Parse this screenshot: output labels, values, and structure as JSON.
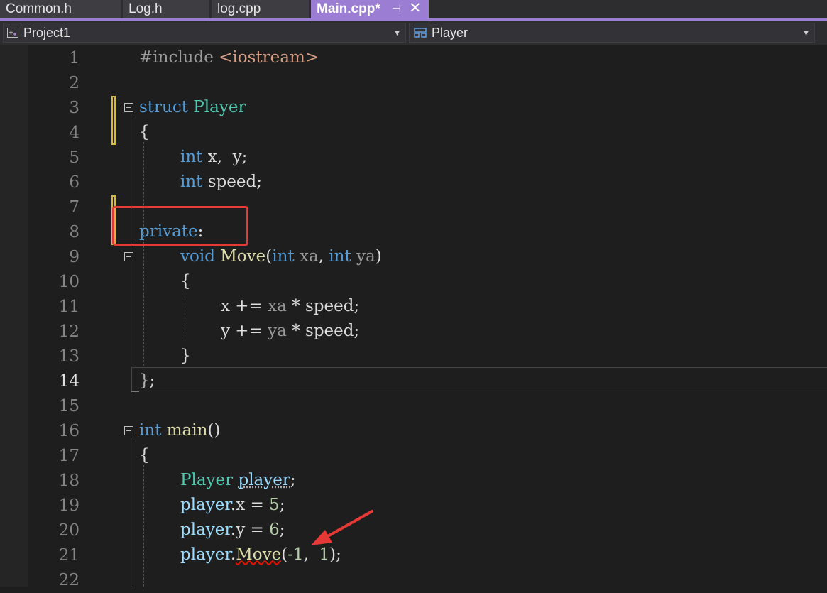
{
  "tabs": [
    {
      "label": "Common.h"
    },
    {
      "label": "Log.h"
    },
    {
      "label": "log.cpp"
    },
    {
      "label": "Main.cpp*",
      "pin": "⊣",
      "close": "✕"
    }
  ],
  "nav": {
    "project": "Project1",
    "member": "Player"
  },
  "editor": {
    "current_line": 14,
    "line_numbers": [
      "1",
      "2",
      "3",
      "4",
      "5",
      "6",
      "7",
      "8",
      "9",
      "10",
      "11",
      "12",
      "13",
      "14",
      "15",
      "16",
      "17",
      "18",
      "19",
      "20",
      "21",
      "22"
    ],
    "lines": {
      "l1": {
        "a": "#include ",
        "b": "<iostream>"
      },
      "l3": {
        "kw": "struct",
        "name": " Player"
      },
      "l4": "{",
      "l5": {
        "kw": "int",
        "rest": " x,  y;"
      },
      "l6": {
        "kw": "int",
        "rest": " speed;"
      },
      "l8": {
        "kw": "private",
        "rest": ":"
      },
      "l9": {
        "kw": "void",
        "fn": " Move",
        "p1": "(",
        "kw2": "int",
        "a1": " xa",
        "c": ", ",
        "kw3": "int",
        "a2": " ya",
        "p2": ")"
      },
      "l10": "{",
      "l11": {
        "v": "x",
        "op": " += ",
        "a": "xa",
        "op2": " * ",
        "s": "speed;"
      },
      "l12": {
        "v": "y",
        "op": " += ",
        "a": "ya",
        "op2": " * ",
        "s": "speed;"
      },
      "l13": "}",
      "l14": {
        "b": "}",
        "s": ";"
      },
      "l16": {
        "kw": "int",
        "fn": " main",
        "p": "()"
      },
      "l17": "{",
      "l18": {
        "ty": "Player",
        "sp": " ",
        "var": "player",
        "s": ";"
      },
      "l19": {
        "v": "player",
        "dot": ".",
        "m": "x",
        "op": " = ",
        "n": "5",
        "s": ";"
      },
      "l20": {
        "v": "player",
        "dot": ".",
        "m": "y",
        "op": " = ",
        "n": "6",
        "s": ";"
      },
      "l21": {
        "v": "player",
        "dot": ".",
        "fn": "Move",
        "p1": "(",
        "n1": "-1",
        "c": ",  ",
        "n2": "1",
        "p2": ");"
      }
    }
  },
  "annotation": {
    "highlight_color": "#e53935",
    "arrow_color": "#e53935"
  }
}
